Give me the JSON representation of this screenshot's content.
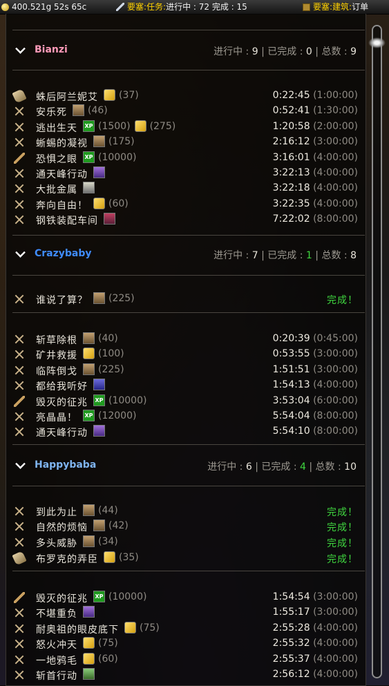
{
  "topbar": {
    "gold": "400.521g 52s 65c",
    "missions_label": "要塞:任务:",
    "missions_status": "进行中 : 72 完成 : 15",
    "buildings_label": "要塞:建筑:",
    "buildings_status": "订单"
  },
  "characters": [
    {
      "name": "Bianzi",
      "name_color": "#ff9ab8",
      "summary": {
        "in_progress_label": "进行中 :",
        "in_progress": "9",
        "completed_label": "已完成 :",
        "completed": "0",
        "total_label": "总数 :",
        "total": "9"
      },
      "completed_missions": [],
      "active_missions": [
        {
          "icon": "scroll-icon",
          "name": "蛛后阿兰妮艾",
          "rewards": [
            {
              "kind": "gold",
              "value": "(37)"
            }
          ],
          "remaining": "0:22:45",
          "duration": "(1:00:00)"
        },
        {
          "icon": "cross-swords-icon",
          "name": "安乐死",
          "rewards": [
            {
              "kind": "chest",
              "value": "(46)"
            }
          ],
          "remaining": "0:52:41",
          "duration": "(1:30:00)"
        },
        {
          "icon": "cross-swords-icon",
          "name": "逃出生天",
          "rewards": [
            {
              "kind": "xp",
              "value": "(1500)"
            },
            {
              "kind": "gold",
              "value": "(275)"
            }
          ],
          "remaining": "1:20:58",
          "duration": "(2:00:00)"
        },
        {
          "icon": "cross-swords-icon",
          "name": "蜥蜴的凝视",
          "rewards": [
            {
              "kind": "chest",
              "value": "(175)"
            }
          ],
          "remaining": "2:16:12",
          "duration": "(3:00:00)"
        },
        {
          "icon": "wand-icon",
          "name": "恐惧之眼",
          "rewards": [
            {
              "kind": "xp",
              "value": "(10000)"
            }
          ],
          "remaining": "3:16:01",
          "duration": "(4:00:00)"
        },
        {
          "icon": "cross-swords-icon",
          "name": "通天峰行动",
          "rewards": [
            {
              "kind": "purple",
              "value": ""
            }
          ],
          "remaining": "3:22:13",
          "duration": "(4:00:00)"
        },
        {
          "icon": "cross-swords-icon",
          "name": "大批金属",
          "rewards": [
            {
              "kind": "item",
              "value": ""
            }
          ],
          "remaining": "3:22:18",
          "duration": "(4:00:00)"
        },
        {
          "icon": "cross-swords-icon",
          "name": "奔向自由！",
          "rewards": [
            {
              "kind": "gold",
              "value": "(60)"
            }
          ],
          "remaining": "3:22:35",
          "duration": "(4:00:00)"
        },
        {
          "icon": "cross-swords-icon",
          "name": "钢铁装配车间",
          "rewards": [
            {
              "kind": "red",
              "value": ""
            }
          ],
          "remaining": "7:22:02",
          "duration": "(8:00:00)"
        }
      ]
    },
    {
      "name": "Crazybaby",
      "name_color": "#3f8cff",
      "summary": {
        "in_progress_label": "进行中 :",
        "in_progress": "7",
        "completed_label": "已完成 :",
        "completed": "1",
        "total_label": "总数 :",
        "total": "8"
      },
      "completed_missions": [
        {
          "icon": "cross-swords-icon",
          "name": "谁说了算？",
          "rewards": [
            {
              "kind": "chest",
              "value": "(225)"
            }
          ],
          "status": "完成！"
        }
      ],
      "active_missions": [
        {
          "icon": "cross-swords-icon",
          "name": "斩草除根",
          "rewards": [
            {
              "kind": "chest",
              "value": "(40)"
            }
          ],
          "remaining": "0:20:39",
          "duration": "(0:45:00)"
        },
        {
          "icon": "cross-swords-icon",
          "name": "矿井救援",
          "rewards": [
            {
              "kind": "gold",
              "value": "(100)"
            }
          ],
          "remaining": "0:53:55",
          "duration": "(3:00:00)"
        },
        {
          "icon": "cross-swords-icon",
          "name": "临阵倒戈",
          "rewards": [
            {
              "kind": "chest",
              "value": "(225)"
            }
          ],
          "remaining": "1:51:51",
          "duration": "(3:00:00)"
        },
        {
          "icon": "cross-swords-icon",
          "name": "都给我听好",
          "rewards": [
            {
              "kind": "blue",
              "value": ""
            }
          ],
          "remaining": "1:54:13",
          "duration": "(4:00:00)"
        },
        {
          "icon": "wand-icon",
          "name": "毁灭的征兆",
          "rewards": [
            {
              "kind": "xp",
              "value": "(10000)"
            }
          ],
          "remaining": "3:53:04",
          "duration": "(6:00:00)"
        },
        {
          "icon": "cross-swords-icon",
          "name": "亮晶晶！",
          "rewards": [
            {
              "kind": "xp",
              "value": "(12000)"
            }
          ],
          "remaining": "5:54:04",
          "duration": "(8:00:00)"
        },
        {
          "icon": "cross-swords-icon",
          "name": "通天峰行动",
          "rewards": [
            {
              "kind": "purple",
              "value": ""
            }
          ],
          "remaining": "5:54:10",
          "duration": "(8:00:00)"
        }
      ]
    },
    {
      "name": "Happybaba",
      "name_color": "#7fb4f0",
      "summary": {
        "in_progress_label": "进行中 :",
        "in_progress": "6",
        "completed_label": "已完成 :",
        "completed": "4",
        "total_label": "总数 :",
        "total": "10"
      },
      "completed_missions": [
        {
          "icon": "cross-swords-icon",
          "name": "到此为止",
          "rewards": [
            {
              "kind": "chest",
              "value": "(44)"
            }
          ],
          "status": "完成！"
        },
        {
          "icon": "cross-swords-icon",
          "name": "自然的烦恼",
          "rewards": [
            {
              "kind": "chest",
              "value": "(42)"
            }
          ],
          "status": "完成！"
        },
        {
          "icon": "cross-swords-icon",
          "name": "多头威胁",
          "rewards": [
            {
              "kind": "chest",
              "value": "(34)"
            }
          ],
          "status": "完成！"
        },
        {
          "icon": "scroll-icon",
          "name": "布罗克的弄臣",
          "rewards": [
            {
              "kind": "gold",
              "value": "(35)"
            }
          ],
          "status": "完成！"
        }
      ],
      "active_missions": [
        {
          "icon": "wand-icon",
          "name": "毁灭的征兆",
          "rewards": [
            {
              "kind": "xp",
              "value": "(10000)"
            }
          ],
          "remaining": "1:54:54",
          "duration": "(3:00:00)"
        },
        {
          "icon": "cross-swords-icon",
          "name": "不堪重负",
          "rewards": [
            {
              "kind": "purple",
              "value": ""
            }
          ],
          "remaining": "1:55:17",
          "duration": "(3:00:00)"
        },
        {
          "icon": "cross-swords-icon",
          "name": "耐奥祖的眼皮底下",
          "rewards": [
            {
              "kind": "gold",
              "value": "(75)"
            }
          ],
          "remaining": "2:55:28",
          "duration": "(4:00:00)"
        },
        {
          "icon": "cross-swords-icon",
          "name": "怒火冲天",
          "rewards": [
            {
              "kind": "gold",
              "value": "(75)"
            }
          ],
          "remaining": "2:55:32",
          "duration": "(4:00:00)"
        },
        {
          "icon": "cross-swords-icon",
          "name": "一地鸦毛",
          "rewards": [
            {
              "kind": "gold",
              "value": "(60)"
            }
          ],
          "remaining": "2:55:37",
          "duration": "(4:00:00)"
        },
        {
          "icon": "cross-swords-icon",
          "name": "斩首行动",
          "rewards": [
            {
              "kind": "green",
              "value": ""
            }
          ],
          "remaining": "2:56:12",
          "duration": "(4:00:00)"
        }
      ]
    }
  ]
}
